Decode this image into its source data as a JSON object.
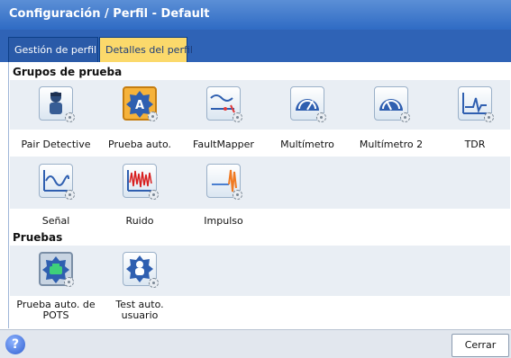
{
  "window": {
    "title": "Configuración / Perfil - Default"
  },
  "tabs": [
    {
      "label": "Gestión de perfil"
    },
    {
      "label": "Detalles del perfil"
    }
  ],
  "sections": {
    "groups": "Grupos de prueba",
    "tests": "Pruebas"
  },
  "groups": [
    {
      "label": "Pair Detective",
      "icon": "pair-detective-icon"
    },
    {
      "label": "Prueba auto.",
      "icon": "auto-test-icon"
    },
    {
      "label": "FaultMapper",
      "icon": "faultmapper-icon"
    },
    {
      "label": "Multímetro",
      "icon": "multimeter-icon"
    },
    {
      "label": "Multímetro 2",
      "icon": "multimeter-2-icon"
    },
    {
      "label": "TDR",
      "icon": "tdr-icon"
    },
    {
      "label": "Señal",
      "icon": "signal-icon"
    },
    {
      "label": "Ruido",
      "icon": "noise-icon"
    },
    {
      "label": "Impulso",
      "icon": "impulse-icon"
    }
  ],
  "tests": [
    {
      "label_line1": "Prueba auto. de",
      "label_line2": "POTS",
      "icon": "pots-auto-test-icon"
    },
    {
      "label_line1": "Test auto.",
      "label_line2": "usuario",
      "icon": "user-auto-test-icon"
    }
  ],
  "footer": {
    "close_label": "Cerrar",
    "help_label": "?"
  },
  "colors": {
    "titlebar": "#2f6bc4",
    "active_tab": "#fbd96b",
    "row_bg": "#e9eef4"
  }
}
